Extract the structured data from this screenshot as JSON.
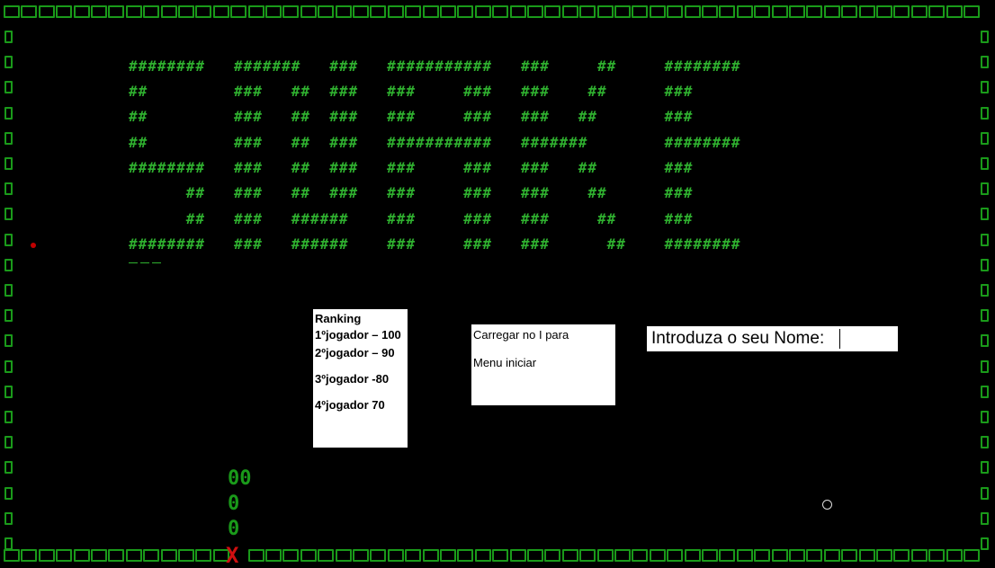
{
  "title_art": [
    "########   #######   ###   ###########   ###     ##     ########",
    "##         ###   ##  ###   ###     ###   ###    ##      ###",
    "##         ###   ##  ###   ###     ###   ###   ##       ###",
    "##         ###   ##  ###   ###########   #######        ########",
    "########   ###   ##  ###   ###     ###   ###   ##       ###",
    "      ##   ###   ##  ###   ###     ###   ###    ##      ###",
    "      ##   ###   ######    ###     ###   ###     ##     ###",
    "########   ###   ######    ###     ###   ###      ##    ########"
  ],
  "ranking": {
    "heading": "Ranking",
    "entries": [
      "1ºjogador – 100",
      "2ºjogador – 90",
      "3ºjogador -80",
      "4ºjogador 70"
    ]
  },
  "info": {
    "line1": "Carregar no I para",
    "line2": "Menu iniciar"
  },
  "name_prompt": {
    "label": "Introduza o seu Nome:"
  },
  "counters": {
    "top": "00",
    "mid": "0",
    "bottom": "0"
  },
  "snake_head": "X",
  "colors": {
    "border": "#1a9a1a",
    "title": "#2fb02f",
    "food": "#c00000",
    "snake_head": "#d01010"
  }
}
